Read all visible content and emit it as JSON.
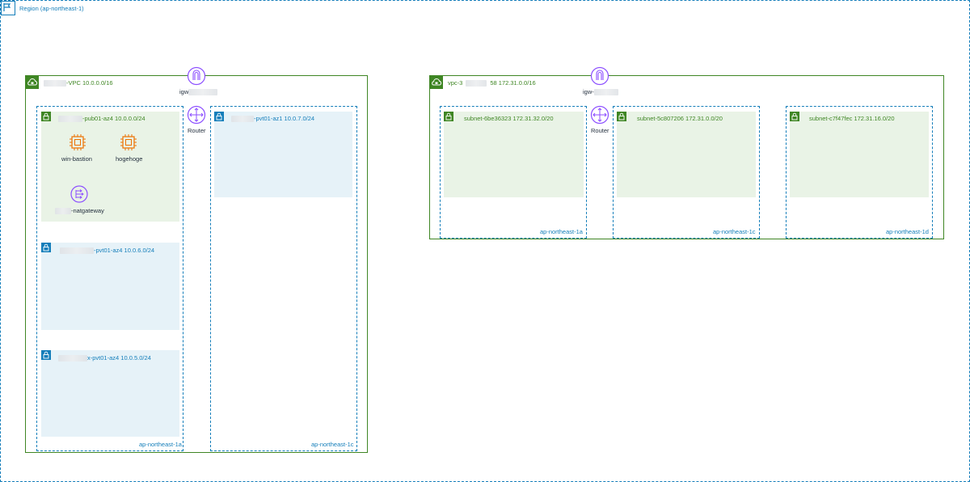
{
  "region": {
    "label": "Region (ap-northeast-1)"
  },
  "vpc1": {
    "label": "-VPC 10.0.0.0/16",
    "igw_label": "igw",
    "router_label": "Router",
    "az_a_label": "ap-northeast-1a",
    "az_c_label": "ap-northeast-1c",
    "subnet_pub": {
      "label": "-pub01-az4 10.0.0.0/24",
      "instances": [
        "win-bastion",
        "hogehoge"
      ],
      "natgateway_label": "-natgateway"
    },
    "subnet_pvt_az1": {
      "label": "-pvt01-az1 10.0.7.0/24"
    },
    "subnet_pvt_az4_6": {
      "label": "-pvt01-az4 10.0.6.0/24"
    },
    "subnet_pvt_az4_5": {
      "label": "x-pvt01-az4 10.0.5.0/24"
    }
  },
  "vpc2": {
    "label_prefix": "vpc-3",
    "label_suffix": "58 172.31.0.0/16",
    "igw_label": "igw-",
    "router_label": "Router",
    "subnets": [
      {
        "label": "subnet-6be36323 172.31.32.0/20",
        "az": "ap-northeast-1a"
      },
      {
        "label": "subnet-5c807206 172.31.0.0/20",
        "az": "ap-northeast-1c"
      },
      {
        "label": "subnet-c7f47fec 172.31.16.0/20",
        "az": "ap-northeast-1d"
      }
    ]
  },
  "colors": {
    "vpc_green": "#3f8624",
    "az_blue": "#147eba",
    "igw_purple": "#8c4fff",
    "ec2_orange": "#ed7100",
    "public_subnet_fill": "#e9f3e6",
    "private_subnet_fill": "#e6f2f8"
  },
  "icons": {
    "region": "region-flag-icon",
    "vpc": "cloud-lock-icon",
    "igw": "internet-gateway-icon",
    "router": "router-icon",
    "subnet": "padlock-icon",
    "ec2": "chip-icon",
    "nat": "nat-gateway-icon"
  }
}
